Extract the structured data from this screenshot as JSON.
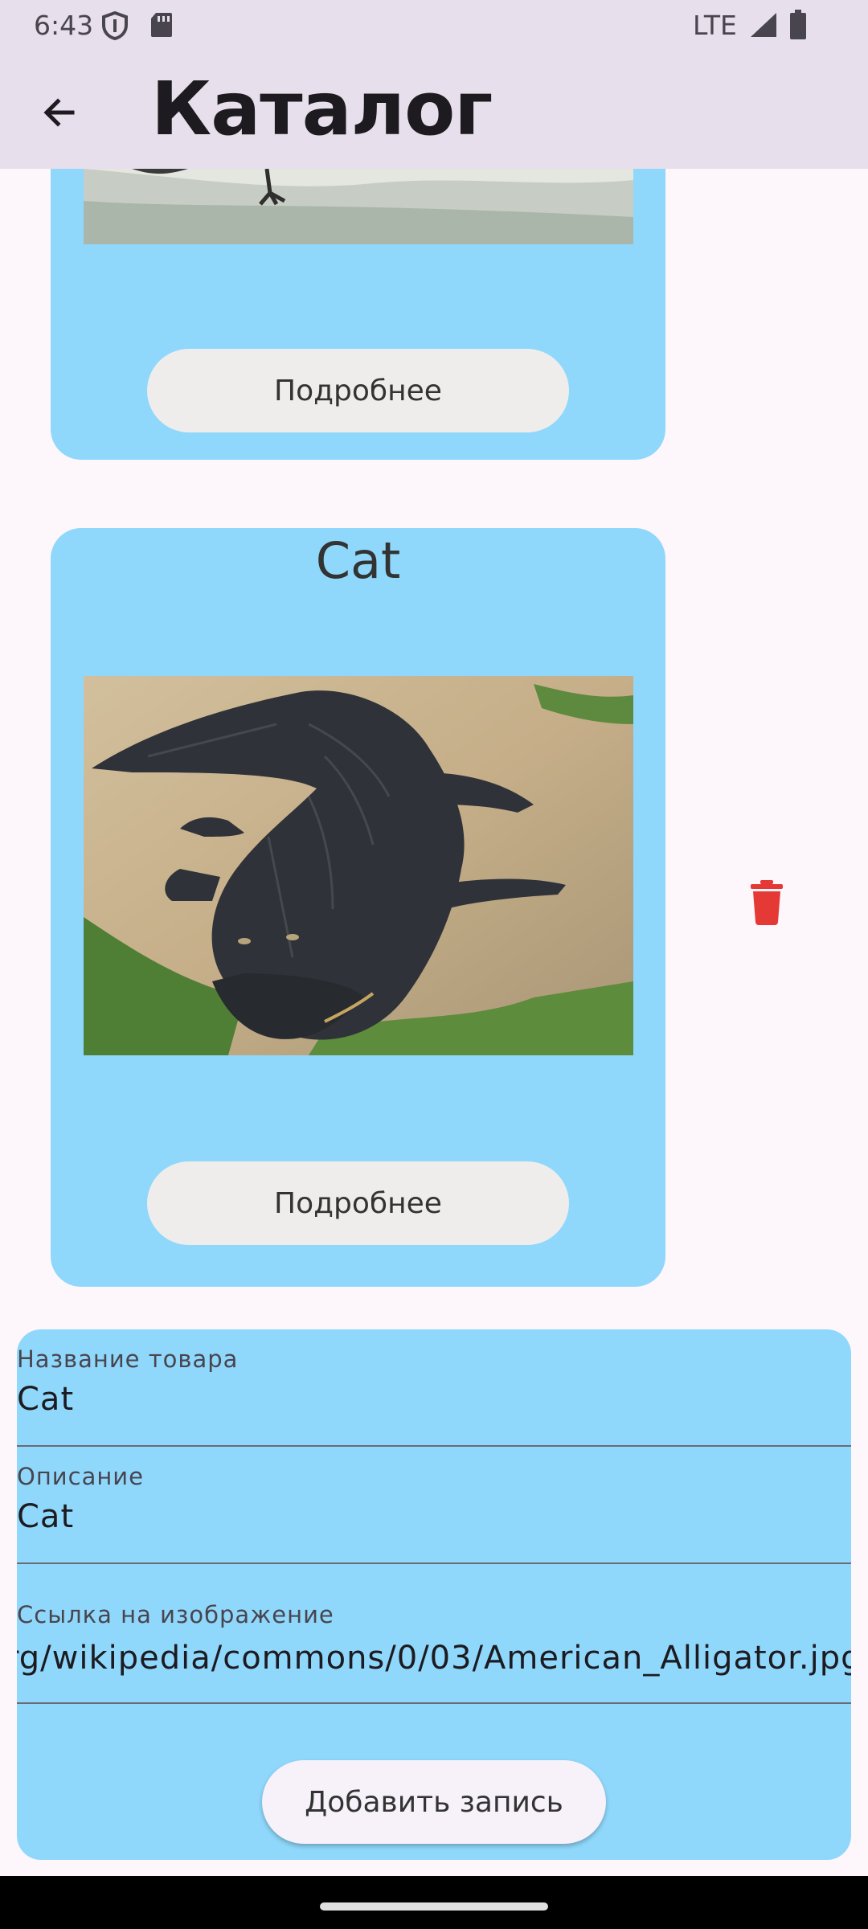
{
  "status_bar": {
    "time": "6:43",
    "network": "LTE",
    "icons": [
      "shield-icon",
      "sd-card-icon",
      "signal-icon",
      "battery-icon"
    ]
  },
  "app_bar": {
    "title": "Каталог",
    "back_icon": "arrow-left-icon"
  },
  "catalog": {
    "items": [
      {
        "name": "",
        "image_alt": "alligator image",
        "details_label": "Подробнее"
      },
      {
        "name": "Cat",
        "image_alt": "American alligator image",
        "details_label": "Подробнее",
        "delete_icon": "trash-icon"
      }
    ]
  },
  "form": {
    "name_label": "Название товара",
    "name_value": "Cat",
    "description_label": "Описание",
    "description_value": "Cat",
    "image_url_label": "Ссылка на изображение",
    "image_url_value": "rg/wikipedia/commons/0/03/American_Alligator.jpg",
    "submit_label": "Добавить запись"
  },
  "colors": {
    "card_bg": "#8fd8fc",
    "app_bar_bg": "#e7dfeb",
    "page_bg": "#fdf6fb",
    "button_bg": "#efedec",
    "delete": "#e53935"
  }
}
